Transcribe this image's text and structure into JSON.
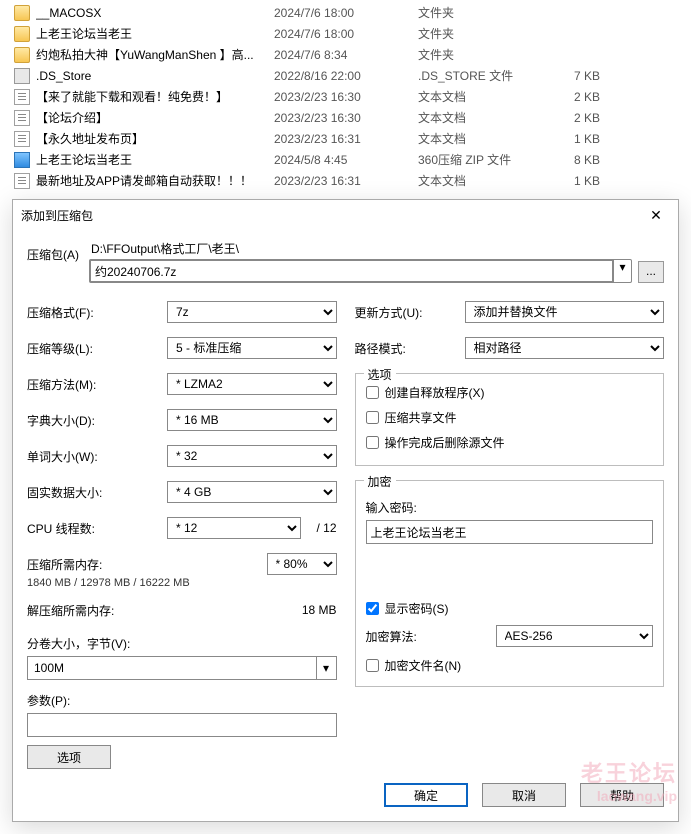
{
  "files": [
    {
      "icon": "folder",
      "name": "__MACOSX",
      "date": "2024/7/6 18:00",
      "type": "文件夹",
      "size": ""
    },
    {
      "icon": "folder",
      "name": "上老王论坛当老王",
      "date": "2024/7/6 18:00",
      "type": "文件夹",
      "size": ""
    },
    {
      "icon": "folder",
      "name": "约炮私拍大神【YuWangManShen 】高...",
      "date": "2024/7/6 8:34",
      "type": "文件夹",
      "size": ""
    },
    {
      "icon": "store",
      "name": ".DS_Store",
      "date": "2022/8/16 22:00",
      "type": ".DS_STORE 文件",
      "size": "7 KB"
    },
    {
      "icon": "txt",
      "name": "【来了就能下载和观看！纯免费！】",
      "date": "2023/2/23 16:30",
      "type": "文本文档",
      "size": "2 KB"
    },
    {
      "icon": "txt",
      "name": "【论坛介绍】",
      "date": "2023/2/23 16:30",
      "type": "文本文档",
      "size": "2 KB"
    },
    {
      "icon": "txt",
      "name": "【永久地址发布页】",
      "date": "2023/2/23 16:31",
      "type": "文本文档",
      "size": "1 KB"
    },
    {
      "icon": "zip",
      "name": "上老王论坛当老王",
      "date": "2024/5/8 4:45",
      "type": "360压缩 ZIP 文件",
      "size": "8 KB"
    },
    {
      "icon": "txt",
      "name": "最新地址及APP请发邮箱自动获取！！！",
      "date": "2023/2/23 16:31",
      "type": "文本文档",
      "size": "1 KB"
    }
  ],
  "dialog": {
    "title": "添加到压缩包",
    "archive": {
      "label": "压缩包(A)",
      "path": "D:\\FFOutput\\格式工厂\\老王\\",
      "file": "约20240706.7z",
      "browse": "..."
    },
    "left": {
      "format": {
        "label": "压缩格式(F):",
        "value": "7z"
      },
      "level": {
        "label": "压缩等级(L):",
        "value": "5 - 标准压缩"
      },
      "method": {
        "label": "压缩方法(M):",
        "value": "* LZMA2"
      },
      "dict": {
        "label": "字典大小(D):",
        "value": "* 16 MB"
      },
      "word": {
        "label": "单词大小(W):",
        "value": "* 32"
      },
      "solid": {
        "label": "固实数据大小:",
        "value": "* 4 GB"
      },
      "threads": {
        "label": "CPU 线程数:",
        "value": "* 12",
        "suffix": "/ 12"
      },
      "mem_c": {
        "label": "压缩所需内存:",
        "pct": "* 80%",
        "note": "1840 MB / 12978 MB / 16222 MB"
      },
      "mem_d": {
        "label": "解压缩所需内存:",
        "value": "18 MB"
      },
      "volume": {
        "label": "分卷大小，字节(V):",
        "value": "100M"
      },
      "params": {
        "label": "参数(P):",
        "value": ""
      },
      "options_btn": "选项"
    },
    "right": {
      "update": {
        "label": "更新方式(U):",
        "value": "添加并替换文件"
      },
      "pathmode": {
        "label": "路径模式:",
        "value": "相对路径"
      },
      "opts": {
        "title": "选项",
        "c1": "创建自释放程序(X)",
        "c2": "压缩共享文件",
        "c3": "操作完成后删除源文件"
      },
      "enc": {
        "title": "加密",
        "pw_label": "输入密码:",
        "pw": "上老王论坛当老王",
        "show": "显示密码(S)",
        "algo_label": "加密算法:",
        "algo": "AES-256",
        "enc_names": "加密文件名(N)"
      }
    },
    "buttons": {
      "ok": "确定",
      "cancel": "取消",
      "help": "帮助"
    }
  },
  "watermark": {
    "l1": "老王论坛",
    "l2": "laowang.vip"
  }
}
